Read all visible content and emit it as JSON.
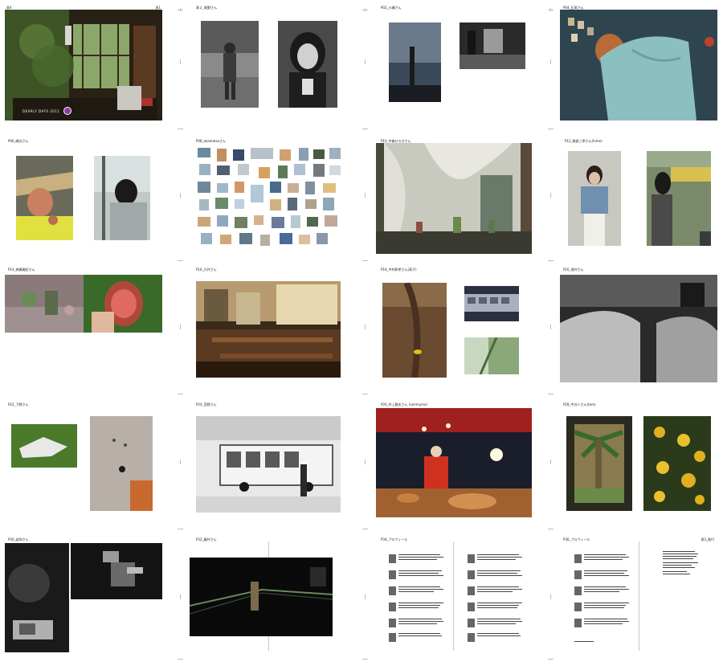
{
  "document": {
    "title": "Dearly Days 2011 contact sheet",
    "cover_title": "DEARLY DAYS 2011"
  },
  "pages": [
    {
      "left": "表4",
      "right": "表1"
    },
    {
      "left": "表２_堀野さん",
      "right": ""
    },
    {
      "left": "P02_川瀬さん",
      "right": ""
    },
    {
      "left": "P04_石塚さん",
      "right": ""
    },
    {
      "left": "P06_嶋谷さん",
      "right": ""
    },
    {
      "left": "P08_akamatsuさん",
      "right": ""
    },
    {
      "left": "P10_中森ひろきさん",
      "right": ""
    },
    {
      "left": "P12_桃坂三季さん(hime)",
      "right": ""
    },
    {
      "left": "P14_斉藤美紀さん",
      "right": ""
    },
    {
      "left": "P16_大井さん",
      "right": ""
    },
    {
      "left": "P18_中村彰孝さん(高子)",
      "right": ""
    },
    {
      "left": "P20_堀井さん",
      "right": ""
    },
    {
      "left": "P22_下野さん",
      "right": ""
    },
    {
      "left": "P24_宮野さん",
      "right": ""
    },
    {
      "left": "P26_井上雅夫さん (iammymo)",
      "right": ""
    },
    {
      "left": "P28_中谷人さん(tom)",
      "right": ""
    },
    {
      "left": "P30_若岡さん",
      "right": ""
    },
    {
      "left": "P32_藤井さん",
      "right": ""
    },
    {
      "left": "P34_プロフィール",
      "right": ""
    },
    {
      "left": "P36_プロフィール",
      "right": "表3_奥付"
    }
  ]
}
